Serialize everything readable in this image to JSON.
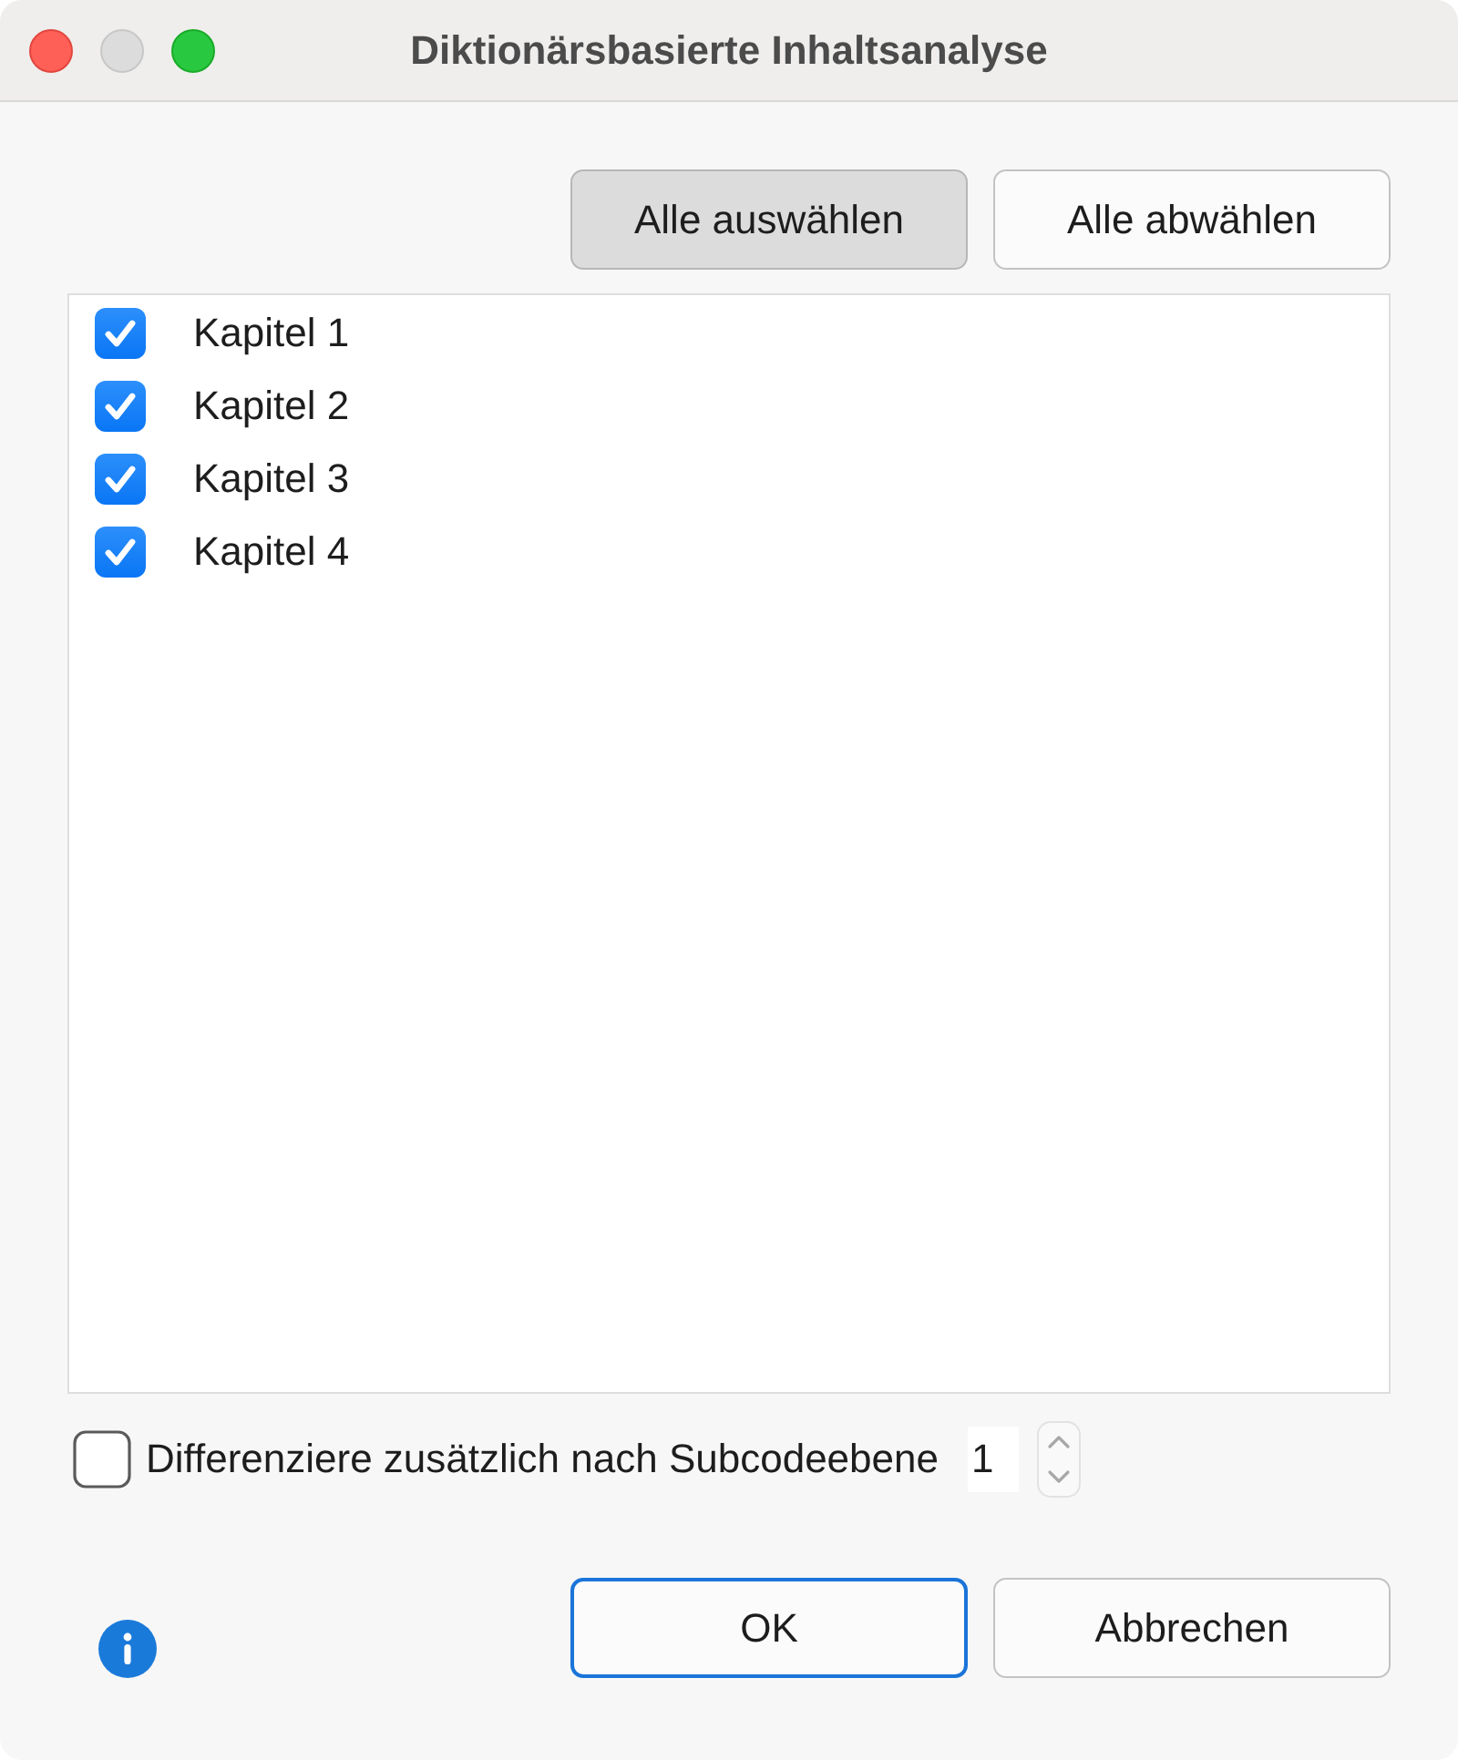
{
  "window": {
    "title": "Diktionärsbasierte Inhaltsanalyse"
  },
  "selection_buttons": [
    {
      "label": "Alle auswählen",
      "highlighted": true
    },
    {
      "label": "Alle abwählen",
      "highlighted": false
    }
  ],
  "documents": [
    {
      "label": "Kapitel 1",
      "checked": true
    },
    {
      "label": "Kapitel 2",
      "checked": true
    },
    {
      "label": "Kapitel 3",
      "checked": true
    },
    {
      "label": "Kapitel 4",
      "checked": true
    }
  ],
  "options": {
    "differentiate": {
      "label": "Differenziere zusätzlich nach Subcodeebene",
      "checked": false
    },
    "subcode_level": {
      "value": "1"
    }
  },
  "footer_buttons": [
    {
      "label": "OK",
      "default": true
    },
    {
      "label": "Abbrechen",
      "default": false
    }
  ]
}
